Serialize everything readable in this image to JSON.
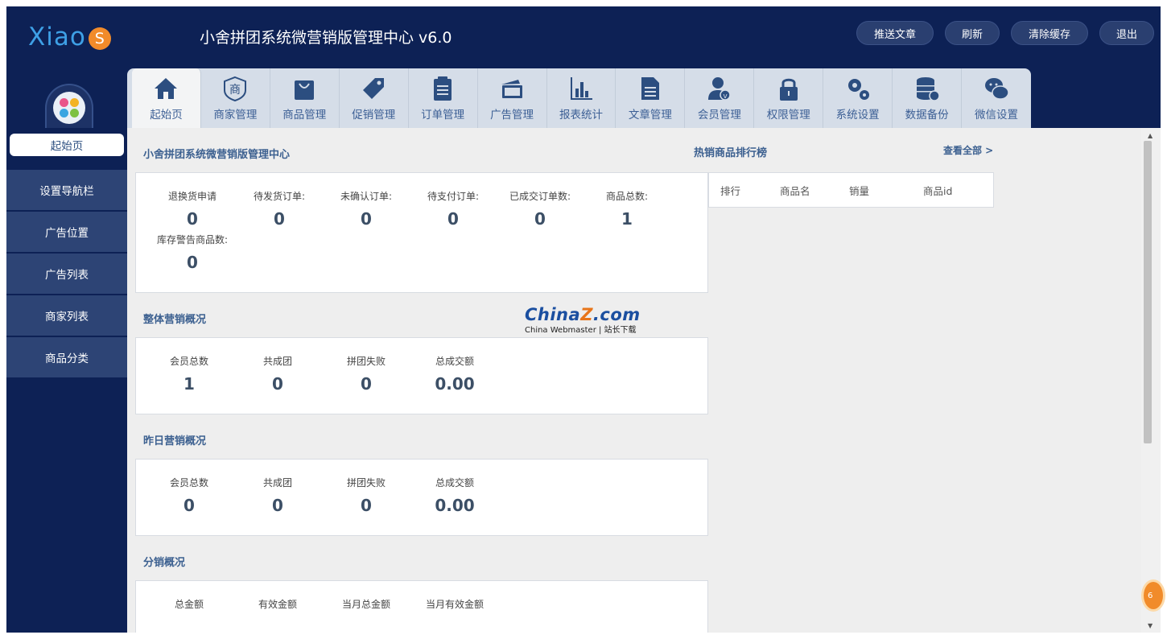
{
  "header": {
    "logo_text": "Xiao",
    "logo_badge": "S",
    "title": "小舍拼团系统微营销版管理中心 v6.0",
    "buttons": [
      "推送文章",
      "刷新",
      "清除缓存",
      "退出"
    ]
  },
  "nav_tabs": [
    {
      "label": "起始页",
      "icon": "home-icon",
      "active": true
    },
    {
      "label": "商家管理",
      "icon": "merchant-icon"
    },
    {
      "label": "商品管理",
      "icon": "shopping-bag-icon"
    },
    {
      "label": "促销管理",
      "icon": "tag-icon"
    },
    {
      "label": "订单管理",
      "icon": "clipboard-icon"
    },
    {
      "label": "广告管理",
      "icon": "cards-icon"
    },
    {
      "label": "报表统计",
      "icon": "bar-chart-icon"
    },
    {
      "label": "文章管理",
      "icon": "document-icon"
    },
    {
      "label": "会员管理",
      "icon": "user-icon"
    },
    {
      "label": "权限管理",
      "icon": "lock-icon"
    },
    {
      "label": "系统设置",
      "icon": "gears-icon"
    },
    {
      "label": "数据备份",
      "icon": "database-icon"
    },
    {
      "label": "微信设置",
      "icon": "wechat-icon"
    }
  ],
  "sidebar": {
    "items": [
      "起始页",
      "设置导航栏",
      "广告位置",
      "广告列表",
      "商家列表",
      "商品分类"
    ]
  },
  "overview": {
    "title": "小舍拼团系统微营销版管理中心",
    "stats": [
      {
        "label": "退换货申请",
        "value": "0"
      },
      {
        "label": "待发货订单:",
        "value": "0"
      },
      {
        "label": "未确认订单:",
        "value": "0"
      },
      {
        "label": "待支付订单:",
        "value": "0"
      },
      {
        "label": "已成交订单数:",
        "value": "0"
      },
      {
        "label": "商品总数:",
        "value": "1"
      },
      {
        "label": "库存警告商品数:",
        "value": "0"
      }
    ]
  },
  "marketing_total": {
    "title": "整体营销概况",
    "stats": [
      {
        "label": "会员总数",
        "value": "1"
      },
      {
        "label": "共成团",
        "value": "0"
      },
      {
        "label": "拼团失败",
        "value": "0"
      },
      {
        "label": "总成交额",
        "value": "0.00"
      }
    ]
  },
  "marketing_yesterday": {
    "title": "昨日营销概况",
    "stats": [
      {
        "label": "会员总数",
        "value": "0"
      },
      {
        "label": "共成团",
        "value": "0"
      },
      {
        "label": "拼团失败",
        "value": "0"
      },
      {
        "label": "总成交额",
        "value": "0.00"
      }
    ]
  },
  "distribution": {
    "title": "分销概况",
    "labels": [
      "总金额",
      "有效金额",
      "当月总金额",
      "当月有效金额"
    ]
  },
  "hot_products": {
    "title": "热销商品排行榜",
    "view_all": "查看全部 >",
    "columns": [
      "排行",
      "商品名",
      "销量",
      "商品id"
    ]
  },
  "watermark": {
    "main_a": "China",
    "main_z": "Z",
    "main_b": ".com",
    "sub": "China Webmaster | 站长下载"
  },
  "float_badge": "6"
}
